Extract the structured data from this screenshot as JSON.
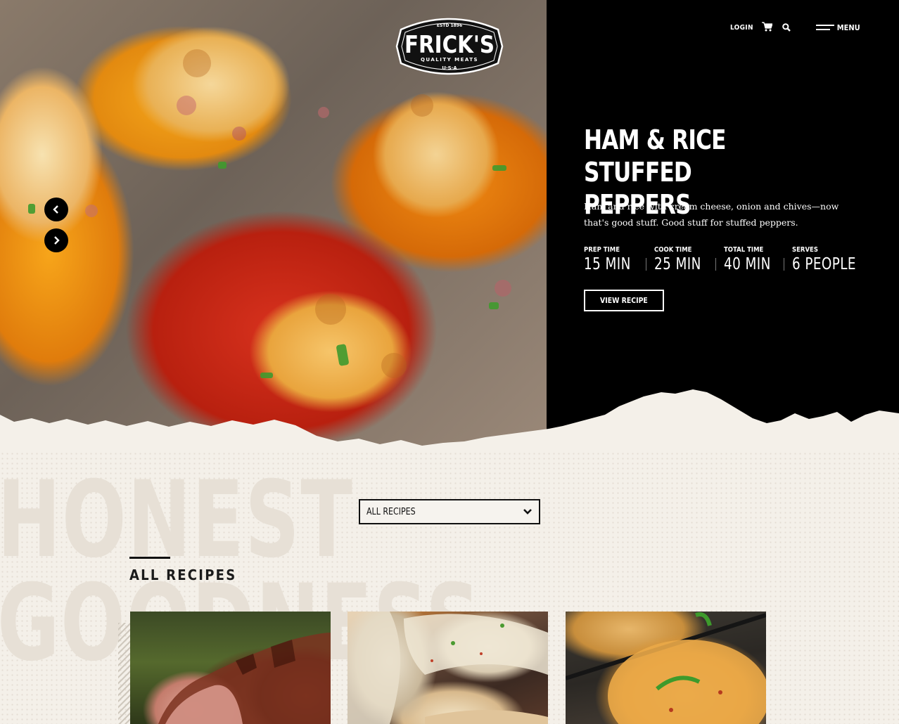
{
  "brand": {
    "estd": "ESTD 1896",
    "name": "FRICK'S",
    "tagline": "QUALITY MEATS",
    "country": "U·S·A"
  },
  "nav": {
    "login_label": "LOGIN",
    "menu_label": "MENU",
    "icons": [
      "cart-icon",
      "search-icon",
      "menu-icon"
    ]
  },
  "hero": {
    "title": "HAM & RICE STUFFED PEPPERS",
    "description": "Ham and rice with cream cheese, onion and chives—now that's good stuff. Good stuff for stuffed peppers.",
    "stats": [
      {
        "label": "PREP TIME",
        "value": "15 MIN"
      },
      {
        "label": "COOK TIME",
        "value": "25 MIN"
      },
      {
        "label": "TOTAL TIME",
        "value": "40 MIN"
      },
      {
        "label": "SERVES",
        "value": "6 PEOPLE"
      }
    ],
    "cta_label": "VIEW RECIPE",
    "carousel": {
      "prev_icon": "chevron-left-icon",
      "next_icon": "chevron-right-icon"
    }
  },
  "background_words": [
    "HONEST",
    "GOODNESS"
  ],
  "filter": {
    "selected": "ALL RECIPES",
    "icon": "chevron-down-icon"
  },
  "section": {
    "title": "ALL RECIPES"
  },
  "colors": {
    "dark": "#000000",
    "cream": "#f4f0e9",
    "text": "#111111",
    "watermark": "#e7e0d6"
  }
}
